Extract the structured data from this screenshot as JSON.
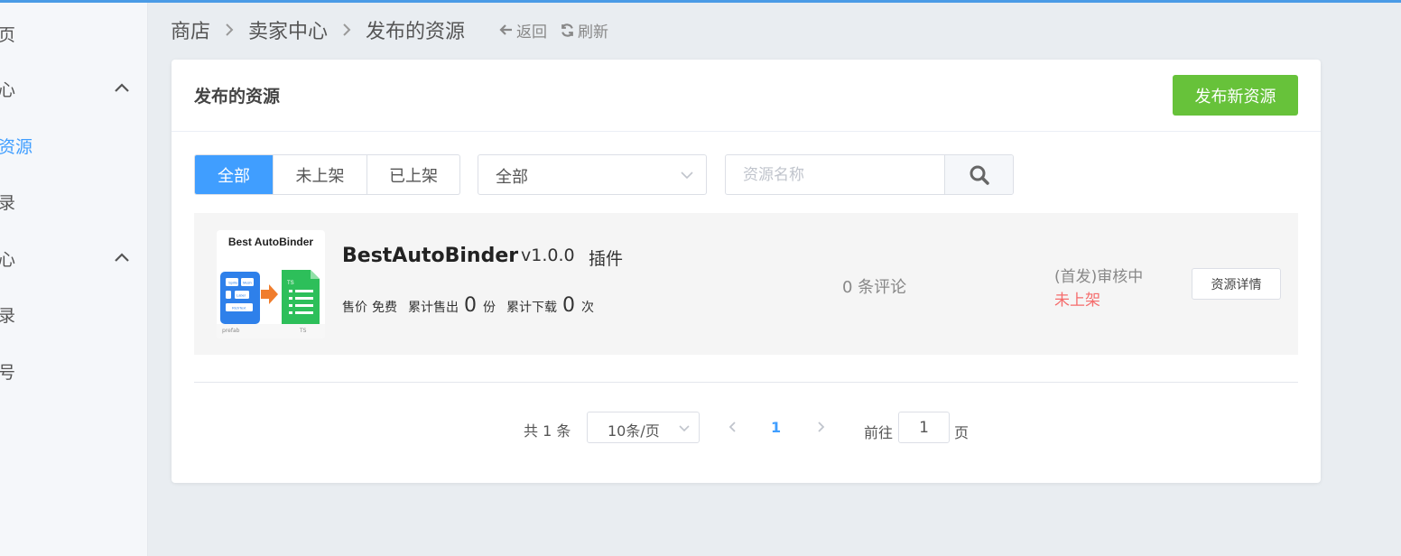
{
  "sidebar": {
    "items": [
      {
        "label": "页"
      },
      {
        "label": "心"
      },
      {
        "label": "资源"
      },
      {
        "label": "录"
      },
      {
        "label": "心"
      },
      {
        "label": "录"
      },
      {
        "label": "号"
      }
    ]
  },
  "breadcrumb": {
    "items": [
      "商店",
      "卖家中心",
      "发布的资源"
    ],
    "back": "返回",
    "refresh": "刷新"
  },
  "card": {
    "title": "发布的资源",
    "publish_button": "发布新资源"
  },
  "filters": {
    "tabs": [
      "全部",
      "未上架",
      "已上架"
    ],
    "active_tab": 0,
    "select_value": "全部",
    "search_placeholder": "资源名称"
  },
  "resource": {
    "thumb_title": "Best AutoBinder",
    "thumb_footer_left": "prefab",
    "thumb_footer_right": "TS",
    "thumb_labels": [
      "Sprite",
      "Mesh",
      "Label",
      "RichText",
      "TS"
    ],
    "name": "BestAutoBinder",
    "version": "v1.0.0",
    "type": "插件",
    "price_label": "售价",
    "price": "免费",
    "sold_label": "累计售出",
    "sold": "0",
    "sold_unit": "份",
    "downloads_label": "累计下载",
    "downloads": "0",
    "downloads_unit": "次",
    "comments": "0 条评论",
    "status_review": "(首发)审核中",
    "status_listing": "未上架",
    "detail_button": "资源详情"
  },
  "pagination": {
    "total": "共 1 条",
    "page_size": "10条/页",
    "current_page": "1",
    "goto_label": "前往",
    "goto_value": "1",
    "page_label": "页"
  },
  "colors": {
    "primary": "#409eff",
    "success": "#67c23a",
    "danger": "#f56c6c"
  }
}
